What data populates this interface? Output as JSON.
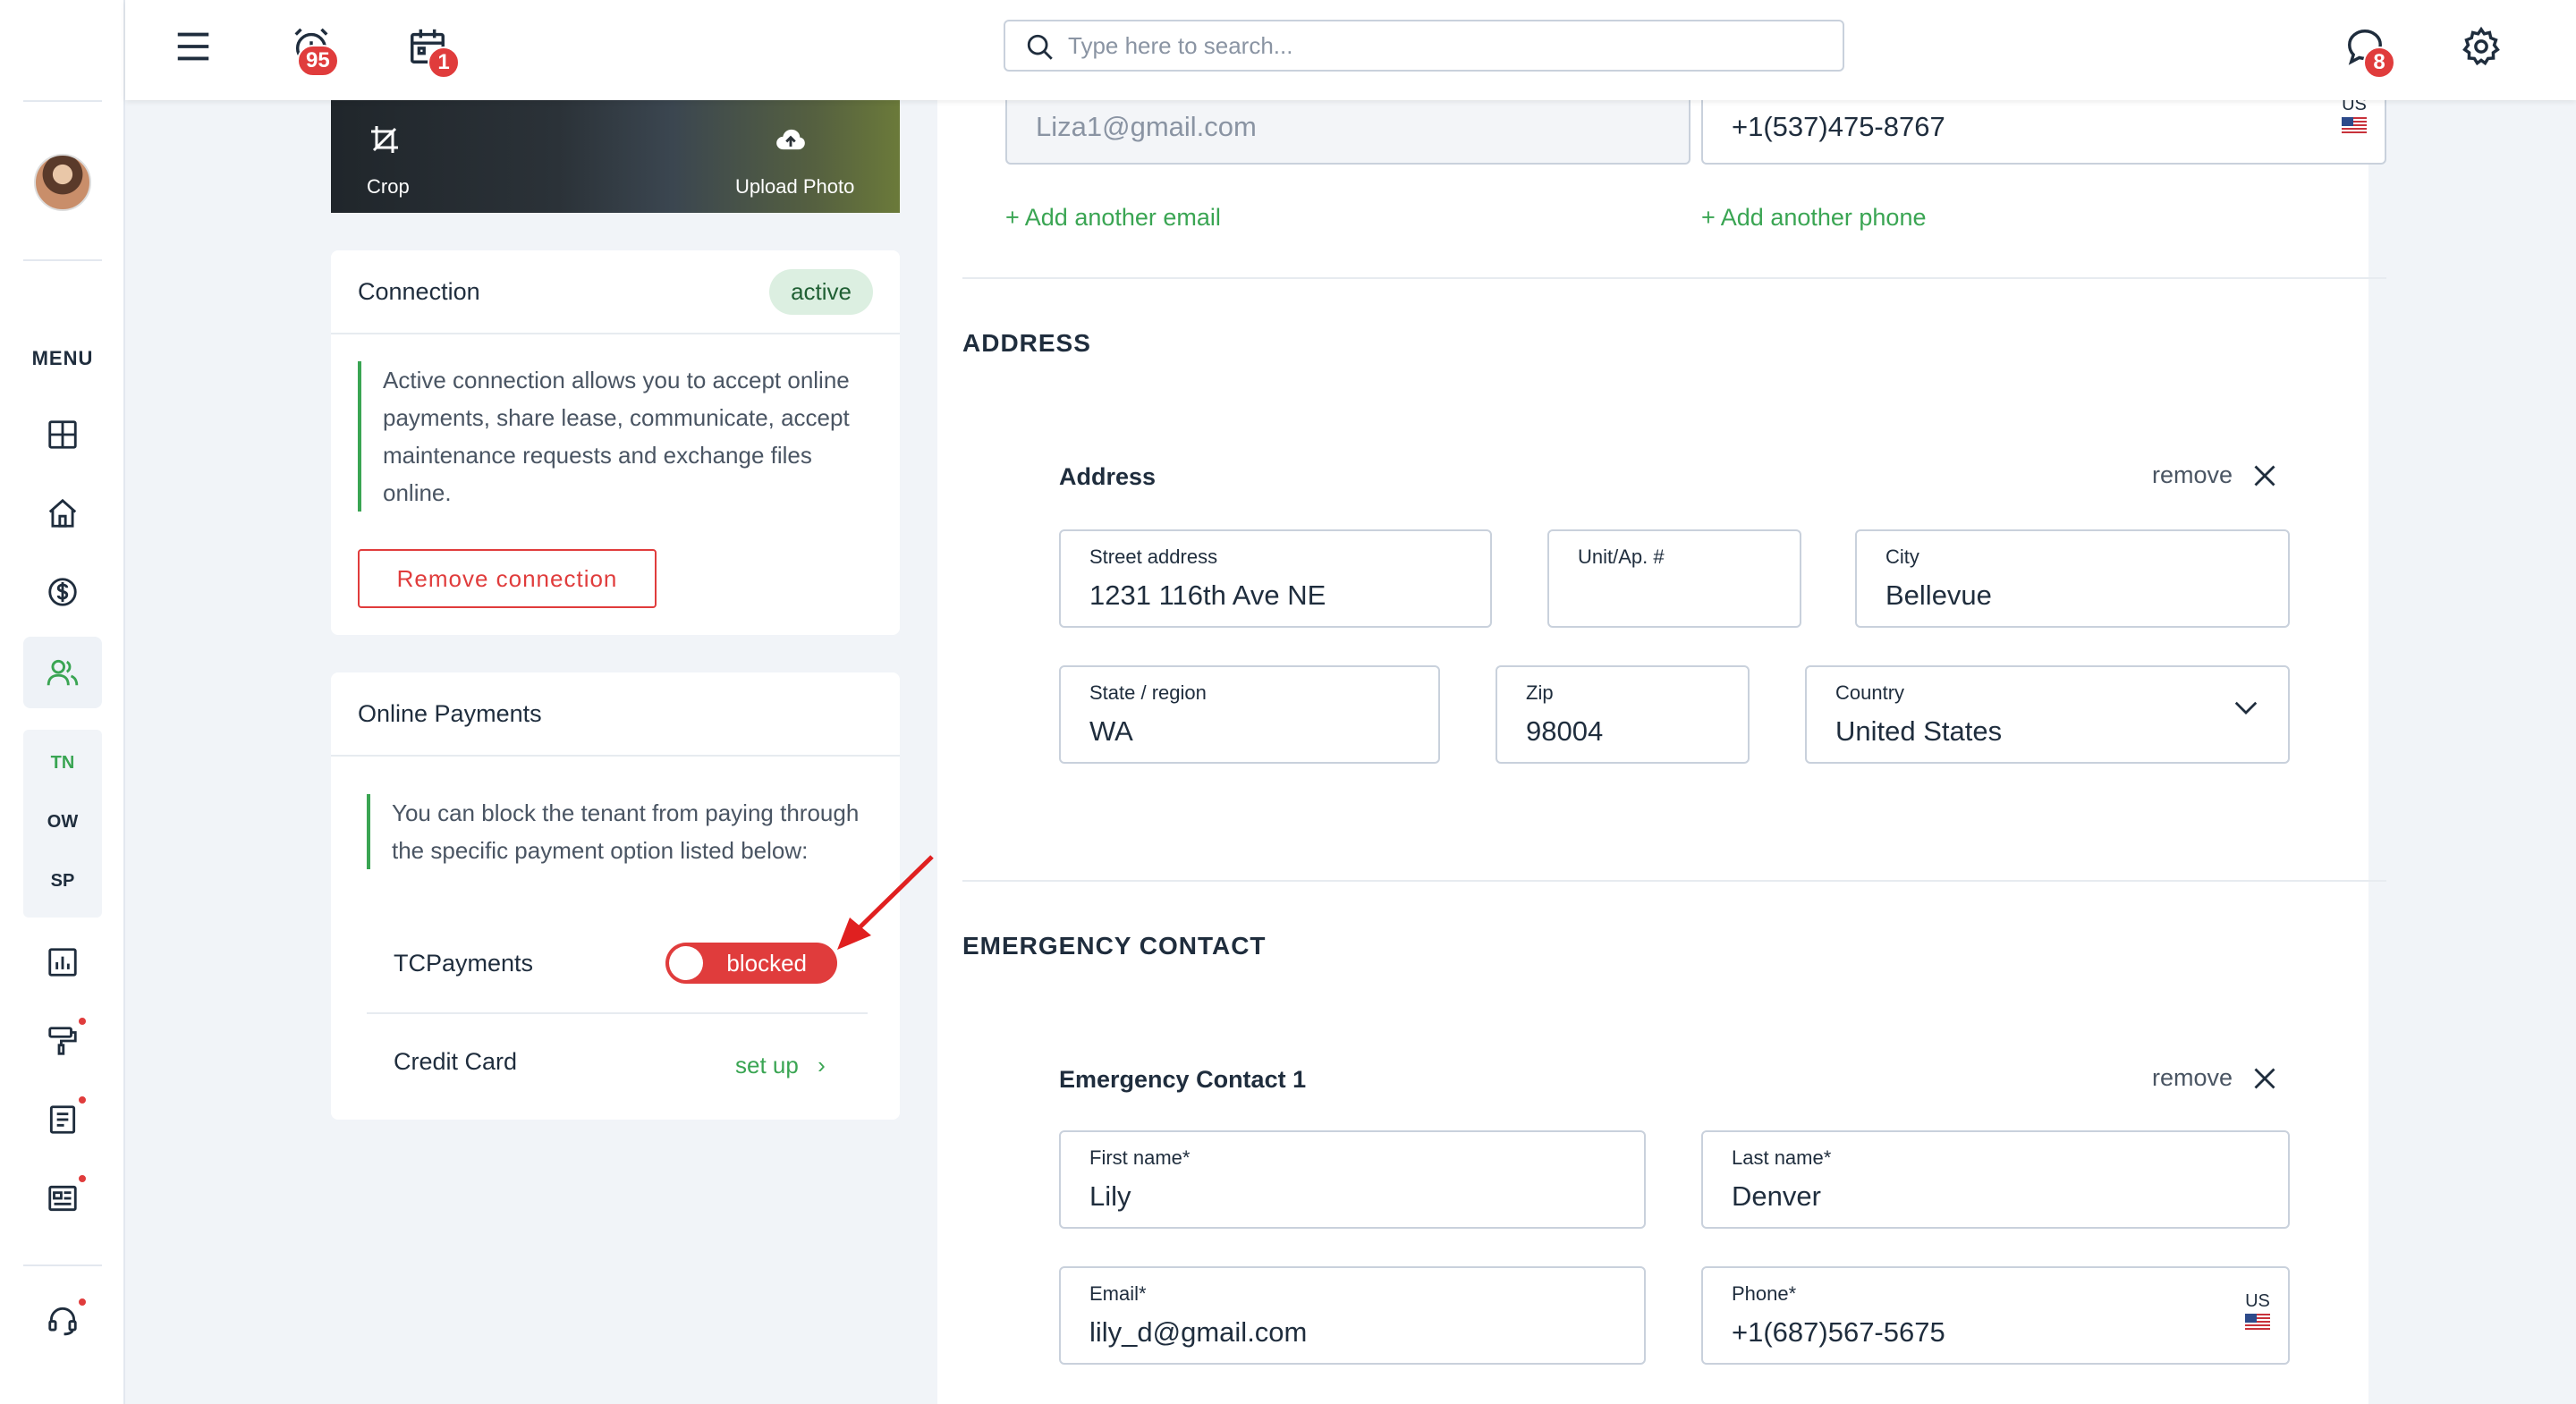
{
  "topbar": {
    "search_placeholder": "Type here to search...",
    "alarm_badge": "95",
    "calendar_badge": "1",
    "chat_badge": "8"
  },
  "sidebar": {
    "menu_label": "MENU",
    "sub_items": [
      "TN",
      "OW",
      "SP"
    ]
  },
  "photo": {
    "crop_label": "Crop",
    "upload_label": "Upload Photo"
  },
  "connection": {
    "title": "Connection",
    "status": "active",
    "note": "Active connection allows you to accept online payments, share lease, communicate, accept maintenance requests and exchange files online.",
    "remove_label": "Remove connection"
  },
  "online_payments": {
    "title": "Online Payments",
    "note": "You can block the tenant from paying through the specific payment option listed below:",
    "tc_label": "TCPayments",
    "tc_status": "blocked",
    "cc_label": "Credit Card",
    "cc_action": "set up"
  },
  "contact": {
    "email": "Liza1@gmail.com",
    "phone": "+1(537)475-8767",
    "phone_country": "US",
    "add_email": "+ Add another email",
    "add_phone": "+ Add another phone"
  },
  "address": {
    "section_title": "ADDRESS",
    "block_title": "Address",
    "remove_label": "remove",
    "street_label": "Street address",
    "street": "1231 116th Ave NE",
    "unit_label": "Unit/Ap. #",
    "unit": "",
    "city_label": "City",
    "city": "Bellevue",
    "state_label": "State / region",
    "state": "WA",
    "zip_label": "Zip",
    "zip": "98004",
    "country_label": "Country",
    "country": "United States"
  },
  "emergency": {
    "section_title": "EMERGENCY CONTACT",
    "block_title": "Emergency Contact 1",
    "remove_label": "remove",
    "first_label": "First name*",
    "first": "Lily",
    "last_label": "Last name*",
    "last": "Denver",
    "email_label": "Email*",
    "email": "lily_d@gmail.com",
    "phone_label": "Phone*",
    "phone": "+1(687)567-5675",
    "phone_country": "US"
  },
  "colors": {
    "accent_green": "#3aa553",
    "danger_red": "#e03c3c",
    "text_dark": "#1f2d3d"
  }
}
